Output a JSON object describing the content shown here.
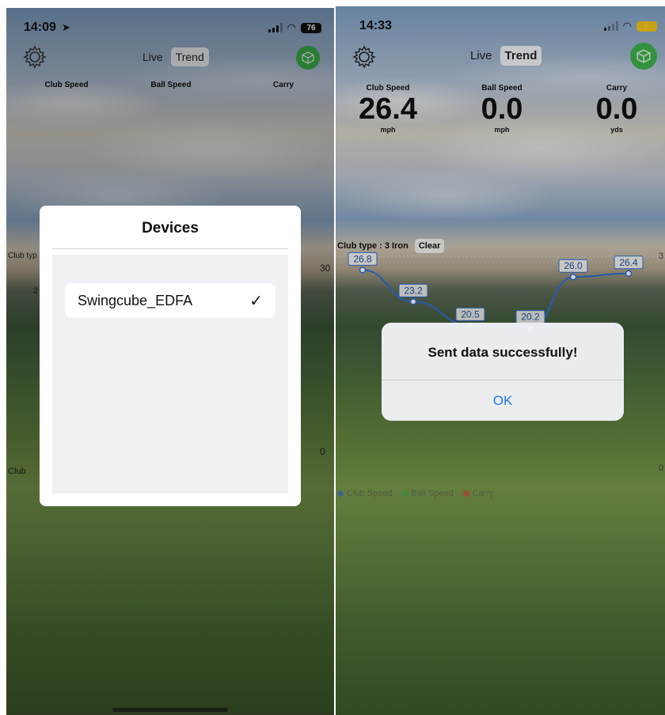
{
  "left": {
    "status": {
      "time": "14:09",
      "battery": "76"
    },
    "header": {
      "live_label": "Live",
      "trend_label": "Trend"
    },
    "metrics": {
      "club_speed_label": "Club Speed",
      "ball_speed_label": "Ball Speed",
      "carry_label": "Carry"
    },
    "side": {
      "club_type_partial": "Club typ",
      "axis_top": "30",
      "axis_bottom": "0",
      "legend_partial": "Club",
      "point_partial": "2"
    },
    "modal": {
      "title": "Devices",
      "device_name": "Swingcube_EDFA",
      "check": "✓"
    }
  },
  "right": {
    "status": {
      "time": "14:33"
    },
    "header": {
      "live_label": "Live",
      "trend_label": "Trend"
    },
    "metrics": [
      {
        "label": "Club Speed",
        "value": "26.4",
        "unit": "mph"
      },
      {
        "label": "Ball Speed",
        "value": "0.0",
        "unit": "mph"
      },
      {
        "label": "Carry",
        "value": "0.0",
        "unit": "yds"
      }
    ],
    "club": {
      "type": "Club type : 3 Iron",
      "clear_label": "Clear"
    },
    "axis": {
      "top": "3",
      "bottom": "0"
    },
    "legend": [
      {
        "name": "Club Speed",
        "color": "#2f6fd6"
      },
      {
        "name": "Ball Speed",
        "color": "#3db24d"
      },
      {
        "name": "Carry",
        "color": "#e23b3b"
      }
    ],
    "alert": {
      "message": "Sent data successfully!",
      "ok_label": "OK"
    }
  },
  "chart_data": {
    "type": "line",
    "series": [
      {
        "name": "Club Speed",
        "values": [
          26.8,
          23.2,
          20.5,
          20.2,
          26.0,
          26.4
        ]
      }
    ],
    "labels": [
      "26.8",
      "23.2",
      "20.5",
      "20.2",
      "26.0",
      "26.4"
    ],
    "ylim": [
      0,
      30
    ],
    "color": "#2f6fd6"
  }
}
